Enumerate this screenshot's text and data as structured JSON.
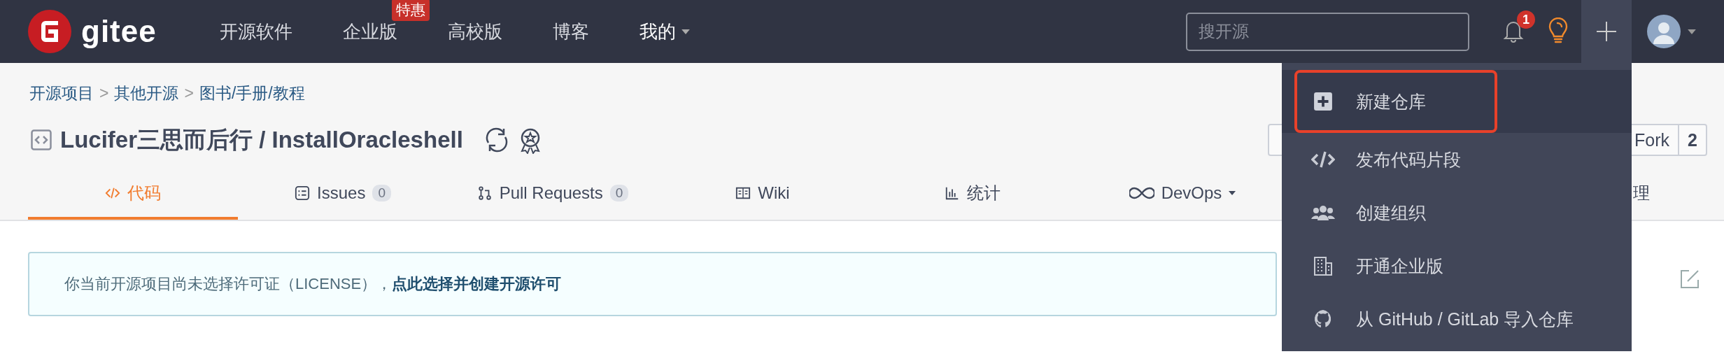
{
  "header": {
    "logo": "gitee",
    "nav": [
      {
        "label": "开源软件"
      },
      {
        "label": "企业版",
        "badge": "特惠"
      },
      {
        "label": "高校版"
      },
      {
        "label": "博客"
      },
      {
        "label": "我的",
        "caret": true
      }
    ],
    "search": {
      "placeholder": "搜开源"
    },
    "notifications": "1"
  },
  "breadcrumb": {
    "separator": ">",
    "items": [
      "开源项目",
      "其他开源",
      "图书/手册/教程"
    ]
  },
  "repo_title": "Lucifer三思而后行 / InstallOracleshell",
  "fork": {
    "label": "Fork",
    "count": "2"
  },
  "tabs": [
    {
      "label": "代码",
      "selected": true
    },
    {
      "label": "Issues",
      "count": "0",
      "selected": false
    },
    {
      "label": "Pull Requests",
      "count": "0",
      "selected": false
    },
    {
      "label": "Wiki",
      "selected": false
    },
    {
      "label": "统计",
      "selected": false
    },
    {
      "label": "DevOps",
      "caret": true,
      "selected": false
    },
    {
      "label": "理",
      "selected": false
    }
  ],
  "notice": {
    "text": "你当前开源项目尚未选择许可证（LICENSE），",
    "link": "点此选择并创建开源许可"
  },
  "create_menu": {
    "items": [
      {
        "label": "新建仓库",
        "selected": true
      },
      {
        "label": "发布代码片段",
        "selected": false
      },
      {
        "label": "创建组织",
        "selected": false
      },
      {
        "label": "开通企业版",
        "selected": false
      },
      {
        "label": "从 GitHub / GitLab 导入仓库",
        "selected": false
      }
    ]
  }
}
